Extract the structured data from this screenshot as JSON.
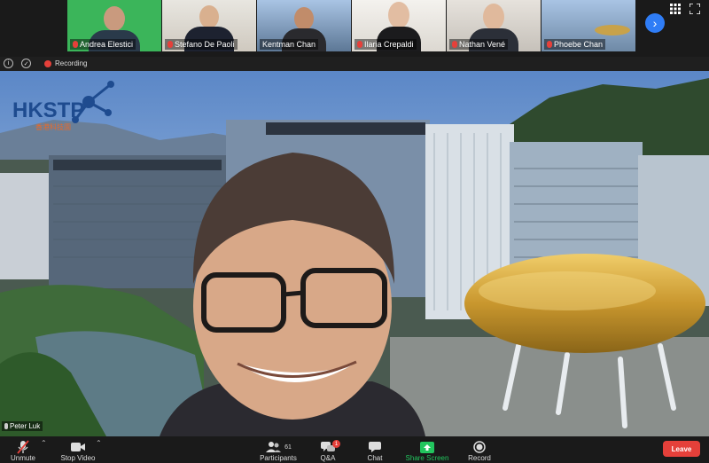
{
  "gallery": {
    "participants": [
      {
        "name": "Andrea Elestici"
      },
      {
        "name": "Stefano De Paoli"
      },
      {
        "name": "Kentman Chan"
      },
      {
        "name": "Ilaria Crepaldi"
      },
      {
        "name": "Nathan Vené"
      },
      {
        "name": "Phoebe Chan"
      }
    ]
  },
  "info_bar": {
    "recording_label": "Recording"
  },
  "background": {
    "logo_text": "HKSTP",
    "logo_sub": "香港科技園"
  },
  "speaker": {
    "name": "Peter Luk"
  },
  "toolbar": {
    "unmute": "Unmute",
    "stop_video": "Stop Video",
    "participants": "Participants",
    "participants_count": "61",
    "qa": "Q&A",
    "qa_badge": "1",
    "chat": "Chat",
    "share_screen": "Share Screen",
    "record": "Record",
    "leave": "Leave"
  },
  "colors": {
    "accent": "#2f7df6",
    "leave": "#e5403a",
    "share": "#22c55e"
  }
}
